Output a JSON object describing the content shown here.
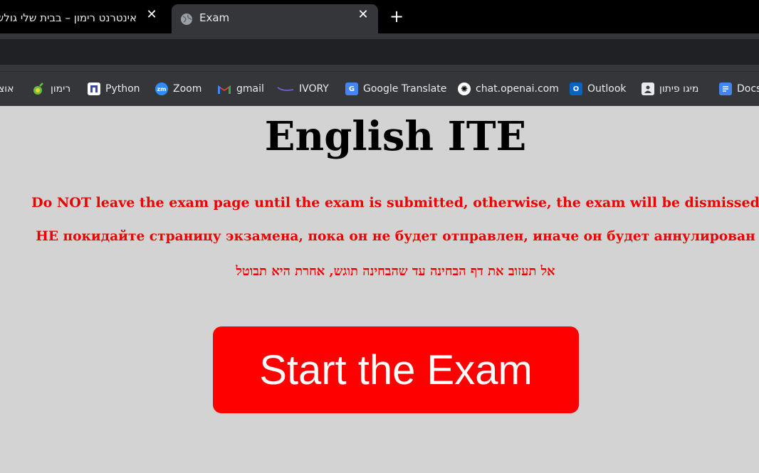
{
  "tabs": [
    {
      "title": "אינטרנט רימון – בבית שלי גולש",
      "active": false,
      "close_icon": "close-icon"
    },
    {
      "title": "Exam",
      "active": true,
      "favicon": "globe-icon",
      "close_icon": "close-icon"
    }
  ],
  "new_tab_icon": "plus-icon",
  "bookmarks": [
    {
      "label": "אוצ",
      "icon": "",
      "rtl": true
    },
    {
      "label": "רימון",
      "icon": "rimon-logo-icon",
      "rtl": true
    },
    {
      "label": "Python",
      "icon": "python-bookmark-icon"
    },
    {
      "label": "Zoom",
      "icon": "zoom-icon"
    },
    {
      "label": "gmail",
      "icon": "gmail-icon"
    },
    {
      "label": "IVORY",
      "icon": "ivory-icon"
    },
    {
      "label": "Google Translate",
      "icon": "google-translate-icon"
    },
    {
      "label": "chat.openai.com",
      "icon": "openai-icon"
    },
    {
      "label": "Outlook",
      "icon": "outlook-icon"
    },
    {
      "label": "מיגו פיתון",
      "icon": "contact-icon",
      "rtl": true
    },
    {
      "label": "Docs",
      "icon": "google-docs-icon"
    }
  ],
  "page": {
    "title": "English ITE",
    "warning_en": "Do NOT leave the exam page until the exam is submitted, otherwise, the exam will be dismissed",
    "warning_ru": "НЕ покидайте страницу экзамена, пока он не будет отправлен, иначе он будет аннулирован",
    "warning_he": "אל תעזוב את דף הבחינה עד שהבחינה תוגש, אחרת היא תבוטל",
    "start_button": "Start the Exam"
  },
  "colors": {
    "page_bg": "#d3d3d3",
    "warning_text": "#ee0000",
    "button_bg": "#ff0000",
    "button_text": "#ffffff",
    "tab_strip": "#000000",
    "toolbar": "#35363a"
  }
}
